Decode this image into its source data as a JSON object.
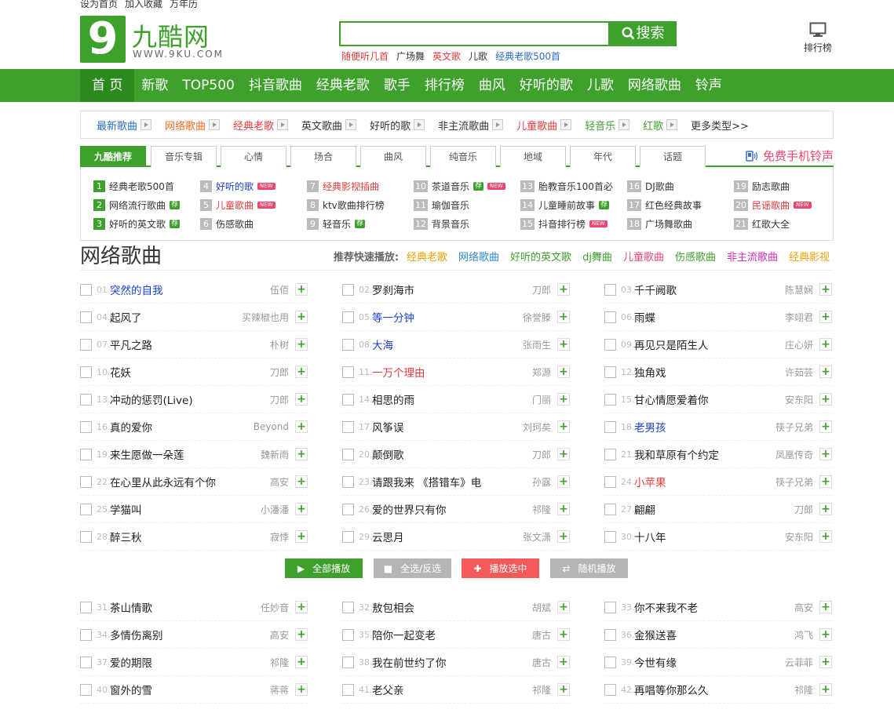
{
  "toplinks": [
    "设为首页",
    "加入收藏",
    "万年历"
  ],
  "logo": {
    "digit": "9",
    "cn": "九酷网",
    "en": "WWW.9KU.COM"
  },
  "search": {
    "value": "",
    "button": "搜索",
    "hot": [
      {
        "t": "随便听几首",
        "c": "#e4393c"
      },
      {
        "t": "广场舞",
        "c": "#333"
      },
      {
        "t": "英文歌",
        "c": "#e4393c"
      },
      {
        "t": "儿歌",
        "c": "#333"
      },
      {
        "t": "经典老歌500首",
        "c": "#2a6ec7"
      }
    ]
  },
  "rank_label": "排行榜",
  "nav": [
    "首 页",
    "新歌",
    "TOP500",
    "抖音歌曲",
    "经典老歌",
    "歌手",
    "排行榜",
    "曲风",
    "好听的歌",
    "儿歌",
    "网络歌曲",
    "铃声"
  ],
  "catbar": [
    {
      "t": "最新歌曲",
      "c": "#2a6ec7"
    },
    {
      "t": "网络歌曲",
      "c": "#f26b1d"
    },
    {
      "t": "经典老歌",
      "c": "#e4393c"
    },
    {
      "t": "英文歌曲",
      "c": "#333"
    },
    {
      "t": "好听的歌",
      "c": "#333"
    },
    {
      "t": "非主流歌曲",
      "c": "#333"
    },
    {
      "t": "儿童歌曲",
      "c": "#e4393c"
    },
    {
      "t": "轻音乐",
      "c": "#3ea12c"
    },
    {
      "t": "红歌",
      "c": "#3ea12c"
    },
    {
      "t": "更多类型>>",
      "c": "#333"
    }
  ],
  "tabs": [
    "九酷推荐",
    "音乐专辑",
    "心情",
    "场合",
    "曲风",
    "纯音乐",
    "地域",
    "年代",
    "话题"
  ],
  "free_ring": "免费手机铃声",
  "rec": [
    {
      "n": "1",
      "t": "经典老歌500首",
      "c": "#333",
      "g": true,
      "b": ""
    },
    {
      "n": "2",
      "t": "网络流行歌曲",
      "c": "#333",
      "g": true,
      "b": "荐"
    },
    {
      "n": "3",
      "t": "好听的英文歌",
      "c": "#333",
      "g": true,
      "b": "荐"
    },
    {
      "n": "4",
      "t": "好听的歌",
      "c": "#1a3fcf",
      "g": false,
      "b": "NEW"
    },
    {
      "n": "5",
      "t": "儿童歌曲",
      "c": "#e4393c",
      "g": false,
      "b": "NEW"
    },
    {
      "n": "6",
      "t": "伤感歌曲",
      "c": "#333",
      "g": false,
      "b": ""
    },
    {
      "n": "7",
      "t": "经典影视插曲",
      "c": "#e4393c",
      "g": false,
      "b": ""
    },
    {
      "n": "8",
      "t": "ktv歌曲排行榜",
      "c": "#333",
      "g": false,
      "b": ""
    },
    {
      "n": "9",
      "t": "轻音乐",
      "c": "#333",
      "g": false,
      "b": "荐"
    },
    {
      "n": "10",
      "t": "茶道音乐",
      "c": "#333",
      "g": false,
      "b": "荐NEW"
    },
    {
      "n": "11",
      "t": "瑜伽音乐",
      "c": "#333",
      "g": false,
      "b": ""
    },
    {
      "n": "12",
      "t": "背景音乐",
      "c": "#333",
      "g": false,
      "b": ""
    },
    {
      "n": "13",
      "t": "胎教音乐100首必",
      "c": "#333",
      "g": false,
      "b": ""
    },
    {
      "n": "14",
      "t": "儿童睡前故事",
      "c": "#333",
      "g": false,
      "b": "荐"
    },
    {
      "n": "15",
      "t": "抖音排行榜",
      "c": "#333",
      "g": false,
      "b": "NEW"
    },
    {
      "n": "16",
      "t": "DJ歌曲",
      "c": "#333",
      "g": false,
      "b": ""
    },
    {
      "n": "17",
      "t": "红色经典故事",
      "c": "#333",
      "g": false,
      "b": ""
    },
    {
      "n": "18",
      "t": "广场舞歌曲",
      "c": "#333",
      "g": false,
      "b": ""
    },
    {
      "n": "19",
      "t": "励志歌曲",
      "c": "#333",
      "g": false,
      "b": ""
    },
    {
      "n": "20",
      "t": "民谣歌曲",
      "c": "#e4393c",
      "g": false,
      "b": "NEW"
    },
    {
      "n": "21",
      "t": "红歌大全",
      "c": "#333",
      "g": false,
      "b": ""
    }
  ],
  "page_title": "网络歌曲",
  "quick": {
    "label": "推荐快速播放:",
    "items": [
      {
        "t": "经典老歌",
        "c": "#f0a000"
      },
      {
        "t": "网络歌曲",
        "c": "#2a8ad2"
      },
      {
        "t": "好听的英文歌",
        "c": "#3ea12c"
      },
      {
        "t": "dj舞曲",
        "c": "#3ea12c"
      },
      {
        "t": "儿童歌曲",
        "c": "#f0466e"
      },
      {
        "t": "伤感歌曲",
        "c": "#3ea12c"
      },
      {
        "t": "非主流歌曲",
        "c": "#d22dbf"
      },
      {
        "t": "经典影视",
        "c": "#f0a000"
      }
    ]
  },
  "songs": [
    {
      "n": "01.",
      "t": "突然的自我",
      "a": "伍佰",
      "c": "#1a3fcf"
    },
    {
      "n": "02.",
      "t": "罗刹海市",
      "a": "刀郎",
      "c": "#222"
    },
    {
      "n": "03.",
      "t": "千千阙歌",
      "a": "陈慧娴",
      "c": "#222"
    },
    {
      "n": "04.",
      "t": "起风了",
      "a": "买辣椒也用",
      "c": "#222"
    },
    {
      "n": "05.",
      "t": "等一分钟",
      "a": "徐誉滕",
      "c": "#1a3fcf"
    },
    {
      "n": "06.",
      "t": "雨蝶",
      "a": "李翊君",
      "c": "#222"
    },
    {
      "n": "07.",
      "t": "平凡之路",
      "a": "朴树",
      "c": "#222"
    },
    {
      "n": "08.",
      "t": "大海",
      "a": "张雨生",
      "c": "#1a3fcf"
    },
    {
      "n": "09.",
      "t": "再见只是陌生人",
      "a": "庄心妍",
      "c": "#222"
    },
    {
      "n": "10.",
      "t": "花妖",
      "a": "刀郎",
      "c": "#222"
    },
    {
      "n": "11.",
      "t": "一万个理由",
      "a": "郑源",
      "c": "#e4393c"
    },
    {
      "n": "12.",
      "t": "独角戏",
      "a": "许茹芸",
      "c": "#222"
    },
    {
      "n": "13.",
      "t": "冲动的惩罚(Live)",
      "a": "刀郎",
      "c": "#222"
    },
    {
      "n": "14.",
      "t": "相思的雨",
      "a": "门丽",
      "c": "#222"
    },
    {
      "n": "15.",
      "t": "甘心情愿爱着你",
      "a": "安东阳",
      "c": "#222"
    },
    {
      "n": "16.",
      "t": "真的爱你",
      "a": "Beyond",
      "c": "#222"
    },
    {
      "n": "17.",
      "t": "风筝误",
      "a": "刘珂矣",
      "c": "#222"
    },
    {
      "n": "18.",
      "t": "老男孩",
      "a": "筷子兄弟",
      "c": "#1a3fcf"
    },
    {
      "n": "19.",
      "t": "来生愿做一朵莲",
      "a": "魏新雨",
      "c": "#222"
    },
    {
      "n": "20.",
      "t": "颠倒歌",
      "a": "刀郎",
      "c": "#222"
    },
    {
      "n": "21.",
      "t": "我和草原有个约定",
      "a": "凤凰传奇",
      "c": "#222"
    },
    {
      "n": "22.",
      "t": "在心里从此永远有个你",
      "a": "高安",
      "c": "#222"
    },
    {
      "n": "23.",
      "t": "请跟我来 《搭错车》电",
      "a": "孙露",
      "c": "#222"
    },
    {
      "n": "24.",
      "t": "小苹果",
      "a": "筷子兄弟",
      "c": "#e4393c"
    },
    {
      "n": "25.",
      "t": "学猫叫",
      "a": "小潘潘",
      "c": "#222"
    },
    {
      "n": "26.",
      "t": "爱的世界只有你",
      "a": "祁隆",
      "c": "#222"
    },
    {
      "n": "27.",
      "t": "翩翩",
      "a": "刀郎",
      "c": "#222"
    },
    {
      "n": "28.",
      "t": "醉三秋",
      "a": "寂悸",
      "c": "#222"
    },
    {
      "n": "29.",
      "t": "云思月",
      "a": "张文潇",
      "c": "#222"
    },
    {
      "n": "30.",
      "t": "十八年",
      "a": "安东阳",
      "c": "#222"
    },
    {
      "n": "31.",
      "t": "茶山情歌",
      "a": "任妙音",
      "c": "#222"
    },
    {
      "n": "32.",
      "t": "敖包相会",
      "a": "胡斌",
      "c": "#222"
    },
    {
      "n": "33.",
      "t": "你不来我不老",
      "a": "高安",
      "c": "#222"
    },
    {
      "n": "34.",
      "t": "多情伤离别",
      "a": "高安",
      "c": "#222"
    },
    {
      "n": "35.",
      "t": "陪你一起变老",
      "a": "唐古",
      "c": "#222"
    },
    {
      "n": "36.",
      "t": "金猴送喜",
      "a": "鸿飞",
      "c": "#222"
    },
    {
      "n": "37.",
      "t": "爱的期限",
      "a": "祁隆",
      "c": "#222"
    },
    {
      "n": "38.",
      "t": "我在前世约了你",
      "a": "唐古",
      "c": "#222"
    },
    {
      "n": "39.",
      "t": "今世有缘",
      "a": "云菲菲",
      "c": "#222"
    },
    {
      "n": "40.",
      "t": "窗外的雪",
      "a": "蒋蒋",
      "c": "#222"
    },
    {
      "n": "41.",
      "t": "老父亲",
      "a": "祁隆",
      "c": "#222"
    },
    {
      "n": "42.",
      "t": "再唱等你那么久",
      "a": "祁隆",
      "c": "#222"
    }
  ],
  "actions": [
    {
      "t": "全部播放",
      "c": "#3ea12c",
      "i": "▶"
    },
    {
      "t": "全选/反选",
      "c": "#b5b5b5",
      "i": "■"
    },
    {
      "t": "播放选中",
      "c": "#f45a5a",
      "i": "✚"
    },
    {
      "t": "随机播放",
      "c": "#b5b5b5",
      "i": "⇄"
    }
  ]
}
